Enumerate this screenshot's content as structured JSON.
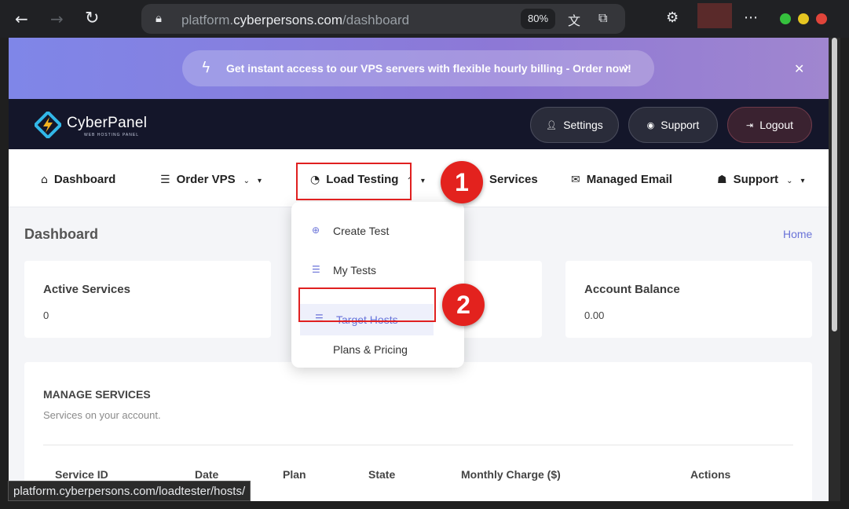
{
  "browser": {
    "url_prefix": "platform.",
    "url_domain": "cyberpersons.com",
    "url_path": "/dashboard",
    "zoom": "80%",
    "status_url": "platform.cyberpersons.com/loadtester/hosts/"
  },
  "promo": {
    "text": "Get instant access to our VPS servers with flexible hourly billing - Order now!"
  },
  "header": {
    "logo": "CyberPanel",
    "logo_sub": "WEB HOSTING PANEL",
    "settings": "Settings",
    "support": "Support",
    "logout": "Logout"
  },
  "nav": {
    "dashboard": "Dashboard",
    "order_vps": "Order VPS",
    "load_testing": "Load Testing",
    "services": "Services",
    "managed_email": "Managed Email",
    "support": "Support"
  },
  "dropdown": {
    "items": [
      "Create Test",
      "My Tests",
      "Target Hosts",
      "Plans & Pricing"
    ]
  },
  "annotations": {
    "step1": "1",
    "step2": "2"
  },
  "page": {
    "title": "Dashboard",
    "breadcrumb": "Home"
  },
  "cards": {
    "active_services_label": "Active Services",
    "active_services_value": "0",
    "account_balance_label": "Account Balance",
    "account_balance_value": "0.00"
  },
  "manage": {
    "title": "MANAGE SERVICES",
    "subtitle": "Services on your account.",
    "columns": [
      "Service ID",
      "Date",
      "Plan",
      "State",
      "Monthly Charge ($)",
      "Actions"
    ]
  },
  "colors": {
    "accent": "#6a73d8",
    "highlight": "#e3221e",
    "header_bg": "#14162a"
  }
}
